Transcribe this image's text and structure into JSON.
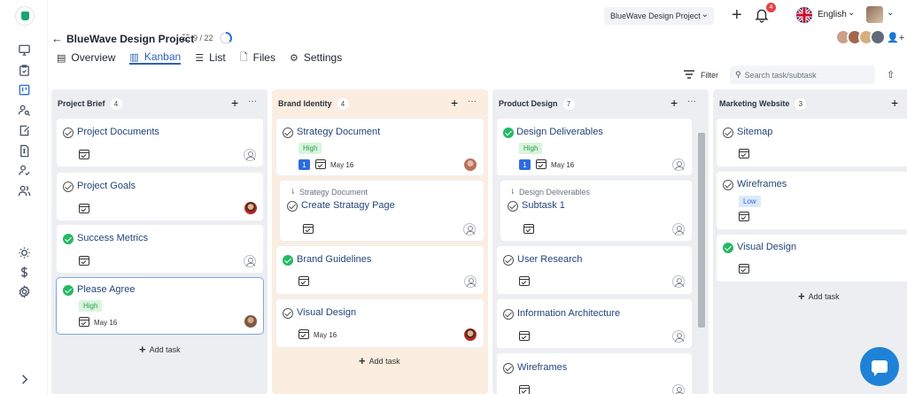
{
  "topbar": {
    "project_select": "BlueWave Design Project",
    "notifications_count": "4",
    "language": "English"
  },
  "project": {
    "title": "BlueWave Design Project",
    "task_count": "9 / 22"
  },
  "tabs": [
    {
      "label": "Overview"
    },
    {
      "label": "Kanban"
    },
    {
      "label": "List"
    },
    {
      "label": "Files"
    },
    {
      "label": "Settings"
    }
  ],
  "toolbar": {
    "filter_label": "Filter",
    "search_placeholder": "Search task/subtask"
  },
  "columns": [
    {
      "title": "Project Brief",
      "count": "4",
      "cards": [
        {
          "title": "Project Documents"
        },
        {
          "title": "Project Goals"
        },
        {
          "title": "Success Metrics"
        },
        {
          "title": "Please Agree",
          "priority": "High",
          "date": "May 16"
        }
      ],
      "add_label": "Add task"
    },
    {
      "title": "Brand Identity",
      "count": "4",
      "cards": [
        {
          "title": "Strategy Document",
          "priority": "High",
          "subtasks": "1",
          "date": "May 16"
        },
        {
          "parent": "Strategy Document",
          "title": "Create Stratagy Page"
        },
        {
          "title": "Brand Guidelines"
        },
        {
          "title": "Visual Design",
          "date": "May 16"
        }
      ],
      "add_label": "Add task"
    },
    {
      "title": "Product Design",
      "count": "7",
      "cards": [
        {
          "title": "Design Deliverables",
          "priority": "High",
          "subtasks": "1",
          "date": "May 16"
        },
        {
          "parent": "Design Deliverables",
          "title": "Subtask 1"
        },
        {
          "title": "User Research"
        },
        {
          "title": "Information Architecture"
        },
        {
          "title": "Wireframes"
        }
      ]
    },
    {
      "title": "Marketing Website",
      "count": "3",
      "cards": [
        {
          "title": "Sitemap"
        },
        {
          "title": "Wireframes",
          "priority": "Low"
        },
        {
          "title": "Visual Design"
        }
      ],
      "add_label": "Add task"
    }
  ],
  "colors": {
    "accent": "#2d5fb4",
    "done_green": "#25b864",
    "column_bg": "#edeef1",
    "brand_column_bg": "#fbeee0",
    "high_badge_bg": "#d8f5dc",
    "low_badge_bg": "#dde8fb"
  }
}
